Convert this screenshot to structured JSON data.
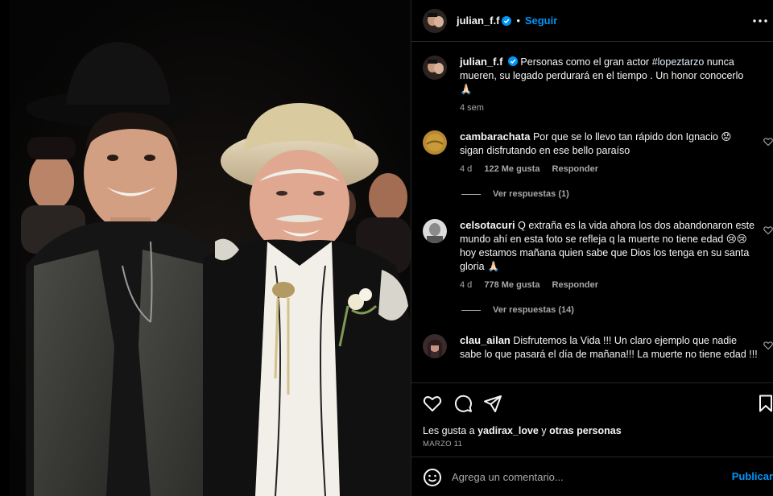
{
  "post": {
    "author": "julian_f.f",
    "follow_label": "Seguir",
    "more_label": "···"
  },
  "caption": {
    "user": "julian_f.f",
    "text_before": "Personas como el gran actor ",
    "hashtag": "#lopeztarzo",
    "text_after": " nunca mueren, su legado perdurará en el tiempo . Un honor conocerlo 🙏🏻",
    "time": "4 sem"
  },
  "comments": [
    {
      "user": "cambarachata",
      "text": "Por que se lo llevo tan rápido don Ignacio 😟 sigan disfrutando en ese bello paraíso",
      "time": "4 d",
      "likes": "122 Me gusta",
      "reply_label": "Responder",
      "replies_label": "Ver respuestas (1)"
    },
    {
      "user": "celsotacuri",
      "text": "Q extraña es la vida ahora los dos abandonaron este mundo ahí en esta foto se refleja q la muerte no tiene edad 😢😢 hoy estamos mañana quien sabe que Dios los tenga en su santa gloria 🙏🏻",
      "time": "4 d",
      "likes": "778 Me gusta",
      "reply_label": "Responder",
      "replies_label": "Ver respuestas (14)"
    },
    {
      "user": "clau_ailan",
      "text": "Disfrutemos la Vida !!! Un claro ejemplo que nadie sabe lo que pasará el día de mañana!!! La muerte no tiene edad !!!"
    }
  ],
  "likes": {
    "prefix": "Les gusta a ",
    "user": "yadirax_love",
    "middle": " y ",
    "others": "otras personas"
  },
  "date": "MARZO 11",
  "composer": {
    "placeholder": "Agrega un comentario...",
    "publish_label": "Publicar"
  },
  "colors": {
    "accent": "#0095f6",
    "background": "#000000",
    "divider": "#262626",
    "secondary_text": "#a8a8a8"
  }
}
